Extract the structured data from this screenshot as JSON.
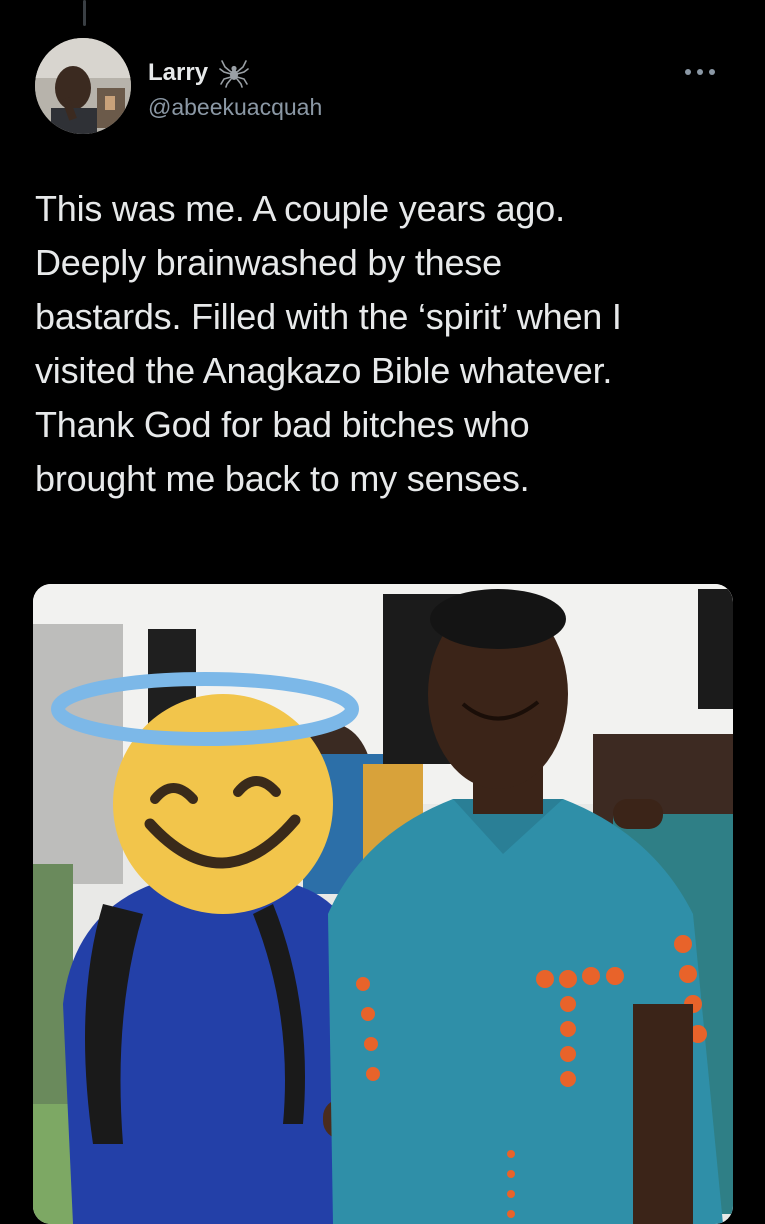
{
  "tweet": {
    "author": {
      "display_name": "Larry",
      "handle": "@abeekuacquah",
      "badge_icon": "spider-icon"
    },
    "more_icon": "more-options-icon",
    "text": "This was me. A couple years ago.\nDeeply brainwashed by these\nbastards. Filled with the ‘spirit’ when I\nvisited the Anagkazo Bible whatever.\nThank God for bad bitches who\nbrought me back to my senses.",
    "media": {
      "type": "photo",
      "overlay_icon": "smiling-face-with-halo-emoji"
    }
  },
  "colors": {
    "background": "#000000",
    "text": "#e7e9ea",
    "secondary_text": "#8b98a5"
  }
}
